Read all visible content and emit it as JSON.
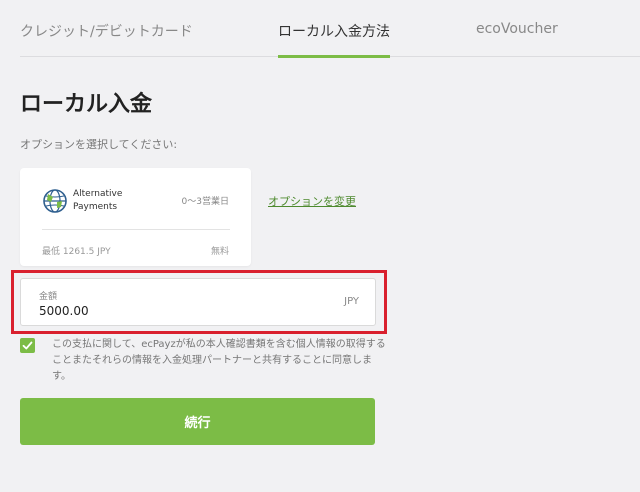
{
  "tabs": [
    {
      "label": "クレジット/デビットカード",
      "active": false
    },
    {
      "label": "ローカル入金方法",
      "active": true
    },
    {
      "label": "ecoVoucher",
      "active": false
    }
  ],
  "page": {
    "title": "ローカル入金",
    "select_label": "オプションを選択してください:"
  },
  "option_card": {
    "provider_line1": "Alternative",
    "provider_line2": "Payments",
    "processing_time": "0〜3営業日",
    "min_amount": "最低 1261.5 JPY",
    "fee": "無料",
    "icon": "globe-payments-icon"
  },
  "change_option_label": "オプションを変更",
  "amount": {
    "label": "金額",
    "value": "5000.00",
    "currency": "JPY"
  },
  "consent": {
    "checked": true,
    "text": "この支払に関して、ecPayzが私の本人確認書類を含む個人情報の取得することまたそれらの情報を入金処理パートナーと共有することに同意します。"
  },
  "continue_label": "続行",
  "colors": {
    "accent": "#7cbc46",
    "highlight": "#d9202e",
    "link": "#4e8a2e",
    "background": "#f1f1f3"
  }
}
